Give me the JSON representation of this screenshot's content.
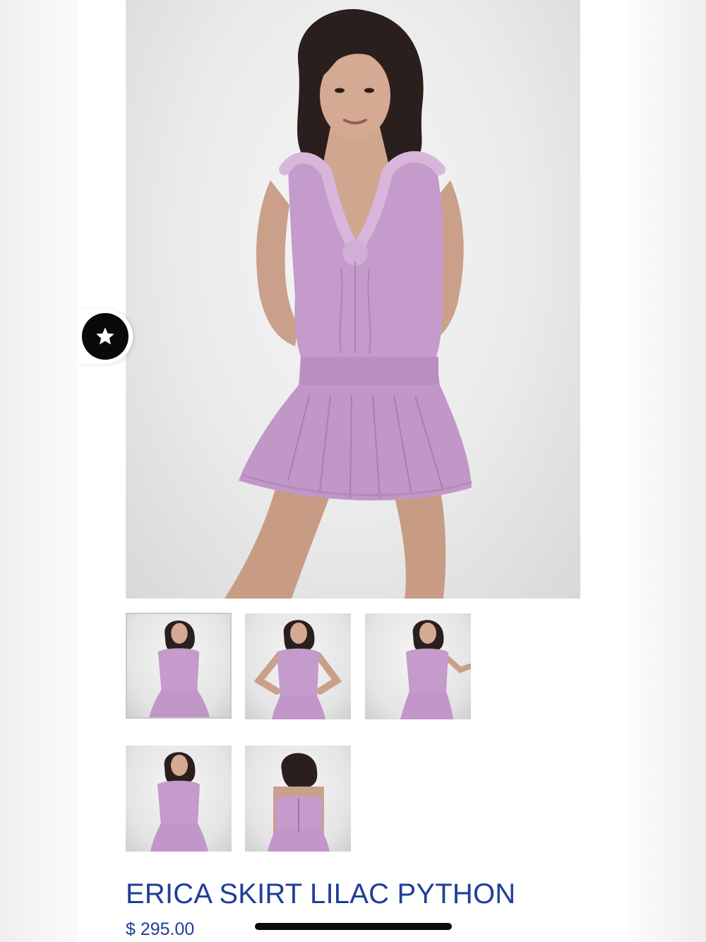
{
  "product": {
    "title": "ERICA SKIRT LILAC PYTHON",
    "price": "$ 295.00"
  },
  "gallery": {
    "main_image": "model-wearing-lilac-ruffle-top-and-skirt-front",
    "thumbnails": [
      {
        "name": "front-smile",
        "active": true
      },
      {
        "name": "hands-on-hips",
        "active": false
      },
      {
        "name": "laughing-arm-out",
        "active": false
      },
      {
        "name": "front-standing",
        "active": false
      },
      {
        "name": "back-view",
        "active": false
      }
    ]
  },
  "floating": {
    "rewards_icon": "star-icon"
  },
  "colors": {
    "accent": "#1f3f97",
    "garment": "#c59acb",
    "rewards_button": "#0a0a0a"
  }
}
